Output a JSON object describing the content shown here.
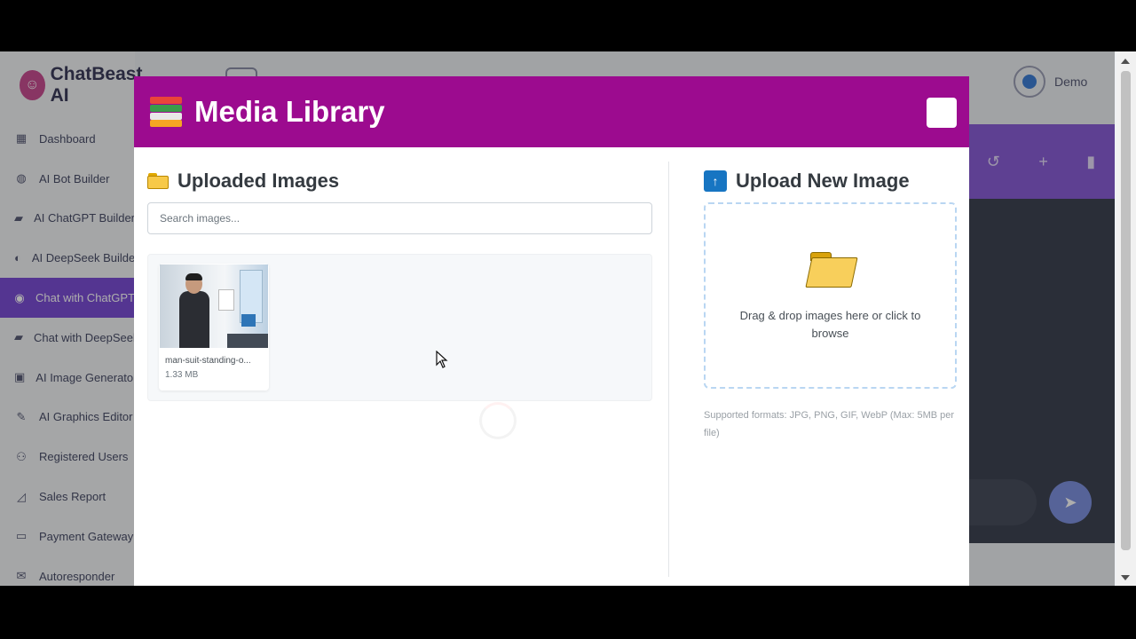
{
  "app": {
    "brand": "ChatBeast AI",
    "user_name": "Demo",
    "nav": [
      {
        "label": "Dashboard",
        "icon": "grid-icon",
        "glyph": "▦"
      },
      {
        "label": "AI Bot Builder",
        "icon": "globe-icon",
        "glyph": "◍"
      },
      {
        "label": "AI ChatGPT Builder",
        "icon": "chat-icon",
        "glyph": "▰"
      },
      {
        "label": "AI DeepSeek Builder",
        "icon": "brain-icon",
        "glyph": "◐"
      },
      {
        "label": "Chat with ChatGPT",
        "icon": "comment-icon",
        "glyph": "◉",
        "active": true
      },
      {
        "label": "Chat with DeepSeek",
        "icon": "comments-icon",
        "glyph": "▰"
      },
      {
        "label": "AI Image Generator",
        "icon": "image-icon",
        "glyph": "▣"
      },
      {
        "label": "AI Graphics Editor",
        "icon": "brush-icon",
        "glyph": "✎"
      },
      {
        "label": "Registered Users",
        "icon": "users-icon",
        "glyph": "⚇"
      },
      {
        "label": "Sales Report",
        "icon": "chart-icon",
        "glyph": "◿"
      },
      {
        "label": "Payment Gateway",
        "icon": "card-icon",
        "glyph": "▭"
      },
      {
        "label": "Autoresponder",
        "icon": "mail-icon",
        "glyph": "✉"
      }
    ]
  },
  "modal": {
    "title": "Media Library",
    "uploaded": {
      "heading": "Uploaded Images",
      "search_placeholder": "Search images...",
      "items": [
        {
          "name": "man-suit-standing-o...",
          "size": "1.33 MB"
        }
      ]
    },
    "upload": {
      "heading": "Upload New Image",
      "icon_glyph": "↑",
      "drop_text": "Drag & drop images here or click to browse",
      "formats": "Supported formats: JPG, PNG, GIF, WebP (Max: 5MB per file)"
    }
  },
  "colors": {
    "modal_header": "#9c0b8f",
    "active_nav": "#7d4fd6",
    "upload_icon": "#1775c2",
    "dropzone_border": "#b9d6f2"
  }
}
